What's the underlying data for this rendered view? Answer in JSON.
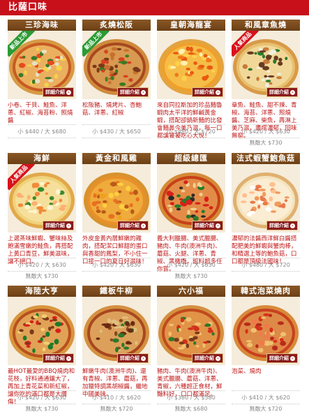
{
  "header": {
    "title": "比薩口味"
  },
  "detail_label": "詳細介紹",
  "colors": {
    "header_red": "#c8101a",
    "title_brown": "#7a4a1c",
    "desc_red": "#c01818",
    "ribbon_green": "#2b9b34",
    "ribbon_red": "#d8121c"
  },
  "pizzas": [
    {
      "name": "三珍海味",
      "badge": "新品上市",
      "badge_color": "green",
      "desc": "小卷、干貝、鮭魚、洋蔥、紅椒、海苔粉、照燒醬",
      "price": "小 $440 / 大 $680",
      "price2": ""
    },
    {
      "name": "炙燒松阪",
      "badge": "新品上市",
      "badge_color": "green",
      "desc": "松阪豬、燒烤片、杏鮑菇、洋蔥、紅椒",
      "price": "小 $430 / 大 $650",
      "price2": ""
    },
    {
      "name": "皇朝海龍宴",
      "badge": "",
      "badge_color": "",
      "desc": "來自同拉斯加的珍品麵魯蝦肉太平洋的鮮鹹黃金蝦，搭配卻鍋新麵的比發會麵鼻今美乃滋，每一口都讓饕饕吃心大悅！",
      "price": "小 $480 / 大 $720",
      "price2": ""
    },
    {
      "name": "和風章魚燒",
      "badge": "人氣商品",
      "badge_color": "red",
      "desc": "章魚、鮭魚、甜不辣、青椒、海苔、洋蔥、照燒醬、芝麻、柴魚，再淋上美乃滋，盡嚐濃郁，回味無窮。",
      "price": "小 $420 / 大 $630",
      "price2": "無敵大 $730"
    },
    {
      "name": "海鮮",
      "badge": "人氣商品",
      "badge_color": "red",
      "desc": "上選蒸味鮮蝦、蟹味絲及飽滿雪嫩的鮭魚，再搭配上黃口青豆，鮮美滋味，讓不絕口。",
      "price": "小 $420 / 大 $630",
      "price2": "無敵大 $730"
    },
    {
      "name": "黃金和風雞",
      "badge": "",
      "badge_color": "",
      "desc": "外皮金黃內層鮮嫩的雞肉，搭配潔口鮮甜的蛋口與香甜的鳳梨，不小住一口接一口的夏日好滋味！",
      "price": "小 $420 / 大 $630",
      "price2": ""
    },
    {
      "name": "超級總匯",
      "badge": "",
      "badge_color": "",
      "desc": "義大利臘腸、美式臘腸、豬肉、牛肉(澳洲牛肉)、蘑菇、火腿、洋蔥、青椒、黑橄欖，館料超多任你嘗。",
      "price": "小 $420 / 大 $630",
      "price2": "無敵大 $730"
    },
    {
      "name": "法式蝦蟹鮑魚菇",
      "badge": "",
      "badge_color": "",
      "desc": "濃郁的法醬西洋鮮白醬搭配肥美的鮮蝦與蟹肉棒，和精選上等的鮑魚菇，口口都是頂級法國味！",
      "price": "小 $480 / 大 $720",
      "price2": ""
    },
    {
      "name": "海陸大亨",
      "badge": "",
      "badge_color": "",
      "desc": "最HOT最愛的BBQ燒肉和花枝，好料通通鑲大了，再加上青花菜和新紅椒，讓你吃的滿口都是大讚傷！",
      "price": "小 $420 / 大 $630",
      "price2": "無敵大 $730"
    },
    {
      "name": "鐵板牛柳",
      "badge": "",
      "badge_color": "",
      "desc": "鮮嫩牛肉(澳洲牛肉)、還有青椒、洋蔥、蘑菇，再加獵特調黑胡椒醬，繼地中國美味。",
      "price": "小 $410 / 大 $620",
      "price2": "無敵大 $720"
    },
    {
      "name": "六小福",
      "badge": "",
      "badge_color": "",
      "desc": "豬肉、牛肉(澳洲牛肉)、美式臘腸、蘑菇、洋蔥、青椒，六種超正食材，鮮豔料好，口口都滿足。",
      "price": "小 $380 / 大 $580",
      "price2": "無敵大 $680"
    },
    {
      "name": "韓式泡菜燒肉",
      "badge": "",
      "badge_color": "",
      "desc": "泡菜、燒肉",
      "price": "小 $410 / 大 $620",
      "price2": "無敵大 $720"
    }
  ]
}
